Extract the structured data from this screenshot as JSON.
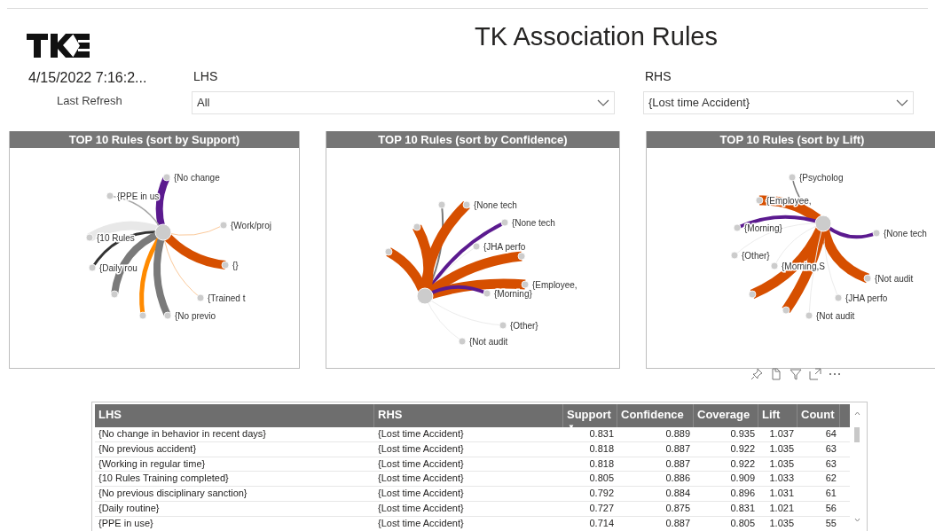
{
  "header": {
    "title": "TK Association Rules",
    "refresh_time": "4/15/2022 7:16:2...",
    "refresh_label": "Last Refresh"
  },
  "filters": [
    {
      "label": "LHS",
      "value": "All"
    },
    {
      "label": "RHS",
      "value": "{Lost time Accident}"
    }
  ],
  "graphs": [
    {
      "title": "TOP 10 Rules (sort by Support)",
      "nodes": [
        {
          "label": "{No change",
          "color": "#5b1a8f"
        },
        {
          "label": "{PPE in us",
          "color": "#a6a6a6"
        },
        {
          "label": "{Work/proj",
          "color": "#fbc99a"
        },
        {
          "label": "{10 Rules",
          "color": "#e8e8e8"
        },
        {
          "label": "{}",
          "color": "#d64f00"
        },
        {
          "label": "{Daily rou",
          "color": "#333333"
        },
        {
          "label": "{Trained t",
          "color": "#fbc99a"
        },
        {
          "color": "#7a7a7a"
        },
        {
          "color": "#ff8a00"
        },
        {
          "label": "{No previo",
          "color": "#7a7a7a"
        }
      ]
    },
    {
      "title": "TOP 10 Rules (sort by Confidence)",
      "nodes": [
        {
          "color": "#7a7a7a"
        },
        {
          "label": "{None tech",
          "color": "#d64f00"
        },
        {
          "label": "{None tech",
          "color": "#5b1a8f"
        },
        {
          "color": "#d64f00"
        },
        {
          "color": "#d64f00"
        },
        {
          "label": "{JHA perfo",
          "color": "#ececec"
        },
        {
          "color": "#d64f00"
        },
        {
          "label": "{Employee,",
          "color": "#d64f00"
        },
        {
          "label": "{Morning}",
          "color": "#5b1a8f"
        },
        {
          "label": "{Other}",
          "color": "#ececec"
        },
        {
          "label": "{Not audit",
          "color": "#ececec"
        }
      ]
    },
    {
      "title": "TOP 10 Rules (sort by Lift)",
      "nodes": [
        {
          "label": "{Psycholog",
          "color": "#7a7a7a"
        },
        {
          "label": "{Employee,",
          "color": "#d64f00"
        },
        {
          "label": "{Morning}",
          "color": "#5b1a8f"
        },
        {
          "label": "{None tech",
          "color": "#5b1a8f"
        },
        {
          "label": "{Other}",
          "color": "#ececec"
        },
        {
          "label": "{Morning,S",
          "color": "#ececec"
        },
        {
          "color": "#d64f00"
        },
        {
          "label": "{Not audit",
          "color": "#d64f00"
        },
        {
          "label": "{JHA perfo",
          "color": "#ececec"
        },
        {
          "color": "#d64f00"
        },
        {
          "label": "{Not audit",
          "color": "#ececec"
        }
      ]
    }
  ],
  "table": {
    "columns": [
      {
        "label": "LHS"
      },
      {
        "label": "RHS"
      },
      {
        "label": "Support",
        "sort_mark": "▼"
      },
      {
        "label": "Confidence"
      },
      {
        "label": "Coverage"
      },
      {
        "label": "Lift"
      },
      {
        "label": "Count"
      }
    ],
    "rows": [
      [
        "{No change in behavior in recent days}",
        "{Lost time Accident}",
        "0.831",
        "0.889",
        "0.935",
        "1.037",
        "64"
      ],
      [
        "{No previous accident}",
        "{Lost time Accident}",
        "0.818",
        "0.887",
        "0.922",
        "1.035",
        "63"
      ],
      [
        "{Working in regular time}",
        "{Lost time Accident}",
        "0.818",
        "0.887",
        "0.922",
        "1.035",
        "63"
      ],
      [
        "{10 Rules Training completed}",
        "{Lost time Accident}",
        "0.805",
        "0.886",
        "0.909",
        "1.033",
        "62"
      ],
      [
        "{No previous disciplinary sanction}",
        "{Lost time Accident}",
        "0.792",
        "0.884",
        "0.896",
        "1.031",
        "61"
      ],
      [
        "{Daily routine}",
        "{Lost time Accident}",
        "0.727",
        "0.875",
        "0.831",
        "1.021",
        "56"
      ],
      [
        "{PPE in use}",
        "{Lost time Accident}",
        "0.714",
        "0.887",
        "0.805",
        "1.035",
        "55"
      ]
    ]
  }
}
